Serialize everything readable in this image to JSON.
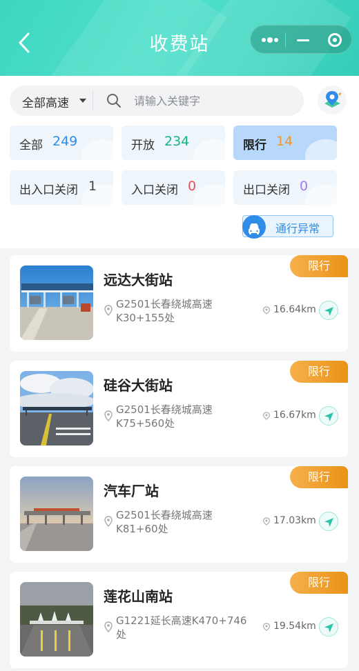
{
  "header": {
    "title": "收费站",
    "back_icon": "chevron-left-icon",
    "capsule": [
      "more-dots-icon",
      "minimize-icon",
      "target-icon"
    ]
  },
  "search": {
    "highway_filter": "全部高速",
    "placeholder": "请输入关键字"
  },
  "stats": [
    {
      "label": "全部",
      "count": "249",
      "color": "#2f8de8"
    },
    {
      "label": "开放",
      "count": "234",
      "color": "#17b383"
    },
    {
      "label": "限行",
      "count": "14",
      "color": "#f0962a"
    },
    {
      "label": "出入口关闭",
      "count": "1",
      "color": "#444444"
    },
    {
      "label": "入口关闭",
      "count": "0",
      "color": "#e8505b"
    },
    {
      "label": "出口关闭",
      "count": "0",
      "color": "#a27be8"
    }
  ],
  "abnormal_button": "通行异常",
  "stations": [
    {
      "name": "远达大街站",
      "road": "G2501长春绕城高速K30+155处",
      "distance": "16.64km",
      "status": "限行"
    },
    {
      "name": "硅谷大街站",
      "road": "G2501长春绕城高速K75+560处",
      "distance": "16.67km",
      "status": "限行"
    },
    {
      "name": "汽车厂站",
      "road": "G2501长春绕城高速K81+60处",
      "distance": "17.03km",
      "status": "限行"
    },
    {
      "name": "莲花山南站",
      "road": "G1221延长高速K470+746处",
      "distance": "19.54km",
      "status": "限行"
    }
  ],
  "colors": {
    "accent": "#3fd6c0",
    "badge": "#ef9a22",
    "link": "#2f8de8"
  }
}
